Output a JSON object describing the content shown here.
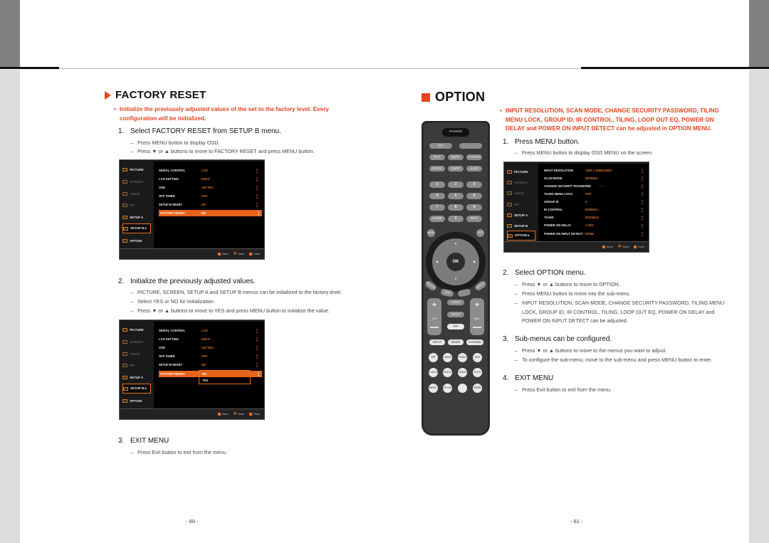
{
  "left_page": {
    "title": "FACTORY RESET",
    "note": "Initialize the previously adjusted values of the set to the factory level. Every configuration will be initialized.",
    "steps": [
      {
        "num": "1.",
        "title": "Select FACTORY RESET from SETUP B menu.",
        "items": [
          "Press MENU button to display OSD.",
          "Press ▼ or ▲ buttons to move to FACTORY RESET and press MENU button."
        ]
      },
      {
        "num": "2.",
        "title": "Initialize the previously adjusted values.",
        "items": [
          "PICTURE, SCREEN, SETUP A and SETUP B menus can be initialized to the factory level.",
          "Select YES or NO for initialization.",
          "Press ▼ or ▲ buttons to move to YES and press MENU button to initialize the value."
        ]
      },
      {
        "num": "3.",
        "title": "EXIT MENU",
        "items": [
          "Press Exit button to exit from the menu."
        ]
      }
    ],
    "page_number": "- 60 -"
  },
  "right_page": {
    "title": "OPTION",
    "note": "INPUT RESOLUTION, SCAN MODE, CHANGE SECURITY PASSWORD, TILING MENU LOCK, GROUP ID, IR CONTROL, TILING, LOOP OUT EQ, POWER ON DELAY and POWER ON INPUT DETECT can be adjusted in OPTION MENU.",
    "steps": [
      {
        "num": "1.",
        "title": "Press MENU button.",
        "items": [
          "Press MENU button to display OSD MENU on the screen."
        ]
      },
      {
        "num": "2.",
        "title": "Select OPTION menu.",
        "items": [
          "Press ▼ or ▲ buttons to move to OPTION.",
          "Press MENU button to move into the sub-menu.",
          "INPUT RESOLUTION, SCAN MODE, CHANGE SECURITY PASSWORD, TILING MENU LOCK, GROUP ID, IR CONTROL, TILING, LOOP OUT EQ, POWER ON DELAY and POWER ON INPUT DETECT can be adjusted."
        ]
      },
      {
        "num": "3.",
        "title": "Sub-menus can be configured.",
        "items": [
          "Press ▼ or ▲ buttons to move to the menus you want to adjust.",
          "To configure the sub-menu, move to the sub-menu and press MENU button to enter."
        ]
      },
      {
        "num": "4.",
        "title": "EXIT MENU",
        "items": [
          "Press Exit button to exit from the menu."
        ]
      }
    ],
    "page_number": "- 61 -"
  },
  "osd_nav": [
    "PICTURE",
    "SCREEN",
    "AUDIO",
    "PIP",
    "SETUP A",
    "SETUP B ▸",
    "OPTION"
  ],
  "osd_nav_option": [
    "PICTURE",
    "SCREEN",
    "AUDIO",
    "PIP",
    "SETUP A",
    "SETUP B",
    "OPTION ▸"
  ],
  "osd_setupb_rows": [
    {
      "label": "SERIAL CONTROL",
      "value": "LAN"
    },
    {
      "label": "LAN SETTING",
      "value": "DHCP"
    },
    {
      "label": "OSD",
      "value": "120 SEC."
    },
    {
      "label": "OFF TIMER",
      "value": "OFF"
    },
    {
      "label": "SETUP B RESET",
      "value": "NO"
    },
    {
      "label": "FACTORY RESET",
      "value": "NO"
    }
  ],
  "osd_dropdown_options": [
    "NO",
    "YES"
  ],
  "osd_option_rows": [
    {
      "label": "INPUT RESOLUTION",
      "value": "1920 x 1080@60Hz"
    },
    {
      "label": "SCAN MODE",
      "value": "NORMAL"
    },
    {
      "label": "CHANGE SECURITY PASSWORD",
      "value": "- - - -"
    },
    {
      "label": "TILING MENU LOCK",
      "value": "OFF"
    },
    {
      "label": "GROUP ID",
      "value": "A"
    },
    {
      "label": "IR CONTROL",
      "value": "NORMAL"
    },
    {
      "label": "TILING",
      "value": "DISABLE"
    },
    {
      "label": "POWER ON DELAY",
      "value": "2 SEC."
    },
    {
      "label": "POWER ON INPUT DETECT",
      "value": "NONE"
    }
  ],
  "osd_footer": {
    "menu": "Menu",
    "move": "Move",
    "enter": "Enter"
  },
  "remote": {
    "power": "POWER",
    "row1": [
      "OFF",
      ""
    ],
    "row2": [
      "PICT.",
      "MUTE",
      "A.SETUP"
    ],
    "row3": [
      "ZOOM",
      "SWAP",
      "A.ADJ"
    ],
    "numpad": [
      "1",
      "2",
      "3",
      "4",
      "5",
      "6",
      "7",
      "8",
      "9",
      "GUIDE",
      "0",
      "INFO"
    ],
    "menu": "MENU",
    "exit": "EXIT",
    "ok": "OK",
    "arc_left": "RELEASE",
    "arc_lan": "LAN",
    "arc_right": "DISPLAY",
    "audio": "AUDIO",
    "input_mid": "INPUT",
    "pip": "PIP",
    "vol": "VOL",
    "sel": "SEL",
    "row_input": [
      "INPUT",
      "MODE",
      "CHANGE"
    ],
    "round1": [
      "DP",
      "HDMI1",
      "HDMI2",
      "DVI"
    ],
    "round2": [
      "DVD/HD",
      "VIDEO1",
      "VIDEO2",
      "SVHS"
    ],
    "round3": [
      "MAG.",
      "OPTION",
      "",
      "RGB"
    ]
  }
}
